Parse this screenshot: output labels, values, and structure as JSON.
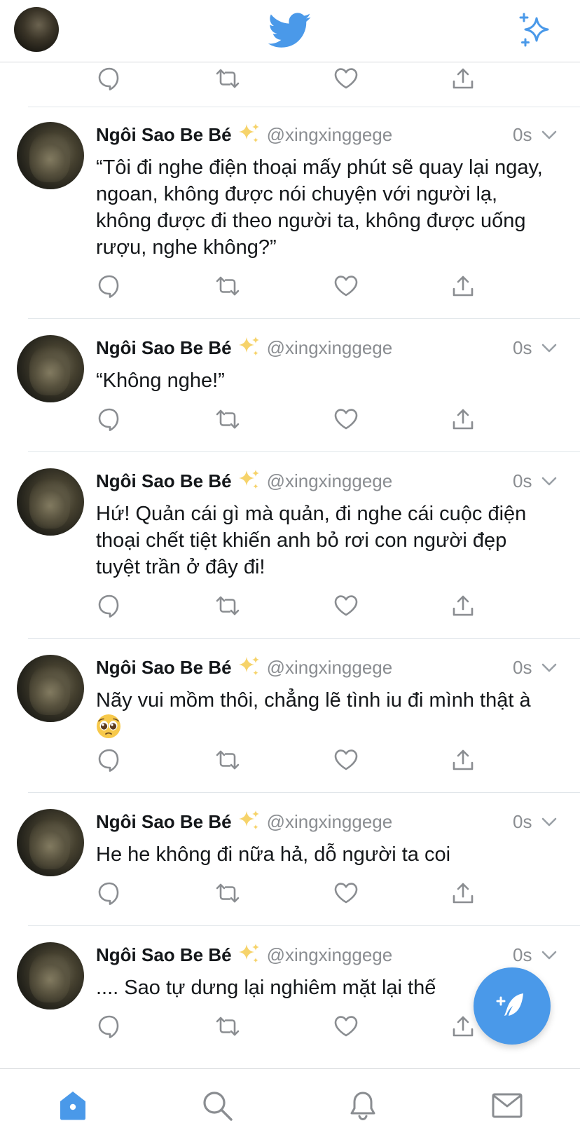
{
  "colors": {
    "accent": "#4a99e9",
    "icon_gray": "#8a8d91",
    "text": "#14171a"
  },
  "header": {
    "logo_icon": "twitter-bird-icon",
    "right_icon": "sparkle-icon"
  },
  "tweets": [
    {
      "name": "Ngôi Sao Be Bé",
      "handle": "@xingxinggege",
      "time": "0s",
      "text": "“Tôi đi nghe điện thoại mấy phút sẽ quay lại ngay, ngoan, không được nói chuyện với người lạ, không được đi theo người ta, không được uống rượu, nghe không?”"
    },
    {
      "name": "Ngôi Sao Be Bé",
      "handle": "@xingxinggege",
      "time": "0s",
      "text": "“Không nghe!”"
    },
    {
      "name": "Ngôi Sao Be Bé",
      "handle": "@xingxinggege",
      "time": "0s",
      "text": "Hứ! Quản cái gì mà quản, đi nghe cái cuộc điện thoại chết tiệt khiến anh bỏ rơi con người đẹp tuyệt trần ở đây đi!"
    },
    {
      "name": "Ngôi Sao Be Bé",
      "handle": "@xingxinggege",
      "time": "0s",
      "text": "Nãy vui mồm thôi, chẳng lẽ tình iu đi mình thật à"
    },
    {
      "name": "Ngôi Sao Be Bé",
      "handle": "@xingxinggege",
      "time": "0s",
      "text": "He he không đi nữa hả, dỗ người ta coi"
    },
    {
      "name": "Ngôi Sao Be Bé",
      "handle": "@xingxinggege",
      "time": "0s",
      "text": ".... Sao tự dưng lại nghiêm mặt lại thế"
    }
  ],
  "actions": [
    "reply-icon",
    "retweet-icon",
    "like-icon",
    "share-icon"
  ],
  "bottom_nav": [
    "home-icon",
    "search-icon",
    "notifications-icon",
    "messages-icon"
  ],
  "fab_icon": "compose-icon"
}
